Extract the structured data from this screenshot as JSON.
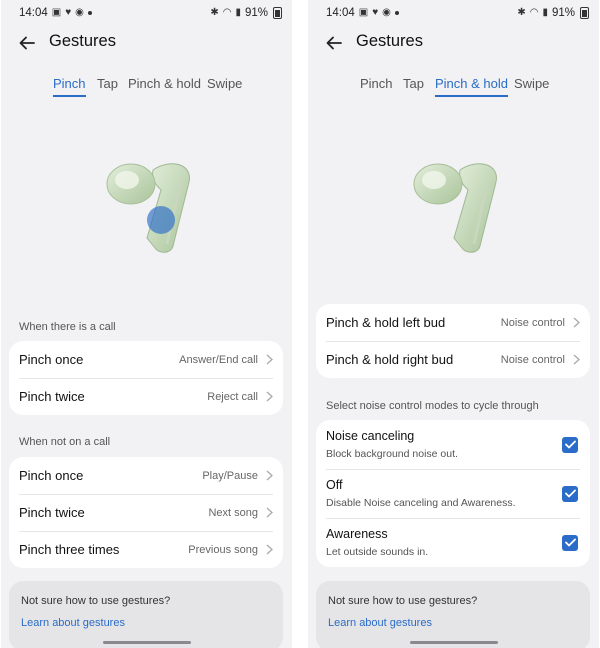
{
  "status_bar": {
    "time": "14:04",
    "battery": "91%"
  },
  "left_screen": {
    "title": "Gestures",
    "tabs": [
      {
        "label": "Pinch",
        "active": true
      },
      {
        "label": "Tap",
        "active": false
      },
      {
        "label": "Pinch & hold",
        "active": false
      },
      {
        "label": "Swipe",
        "active": false
      }
    ],
    "sections": [
      {
        "label": "When there is a call",
        "rows": [
          {
            "label": "Pinch once",
            "value": "Answer/End call"
          },
          {
            "label": "Pinch twice",
            "value": "Reject call"
          }
        ]
      },
      {
        "label": "When not on a call",
        "rows": [
          {
            "label": "Pinch once",
            "value": "Play/Pause"
          },
          {
            "label": "Pinch twice",
            "value": "Next song"
          },
          {
            "label": "Pinch three times",
            "value": "Previous song"
          }
        ]
      }
    ],
    "help": {
      "text": "Not sure how to use gestures?",
      "link": "Learn about gestures"
    }
  },
  "right_screen": {
    "title": "Gestures",
    "tabs": [
      {
        "label": "Pinch",
        "active": false
      },
      {
        "label": "Tap",
        "active": false
      },
      {
        "label": "Pinch & hold",
        "active": true
      },
      {
        "label": "Swipe",
        "active": false
      }
    ],
    "buds": [
      {
        "label": "Pinch & hold left bud",
        "value": "Noise control"
      },
      {
        "label": "Pinch & hold right bud",
        "value": "Noise control"
      }
    ],
    "modes_label": "Select noise control modes to cycle through",
    "modes": [
      {
        "title": "Noise canceling",
        "subtitle": "Block background noise out.",
        "checked": true
      },
      {
        "title": "Off",
        "subtitle": "Disable Noise canceling and Awareness.",
        "checked": true
      },
      {
        "title": "Awareness",
        "subtitle": "Let outside sounds in.",
        "checked": true
      }
    ],
    "help": {
      "text": "Not sure how to use gestures?",
      "link": "Learn about gestures"
    }
  },
  "colors": {
    "accent": "#2a6cc7",
    "background": "#f2f2f4",
    "card": "#ffffff",
    "help_card": "#e5e5e8"
  },
  "icons": [
    "back-arrow-icon",
    "chevron-right-icon",
    "checkbox-checked-icon",
    "earbud-image"
  ]
}
